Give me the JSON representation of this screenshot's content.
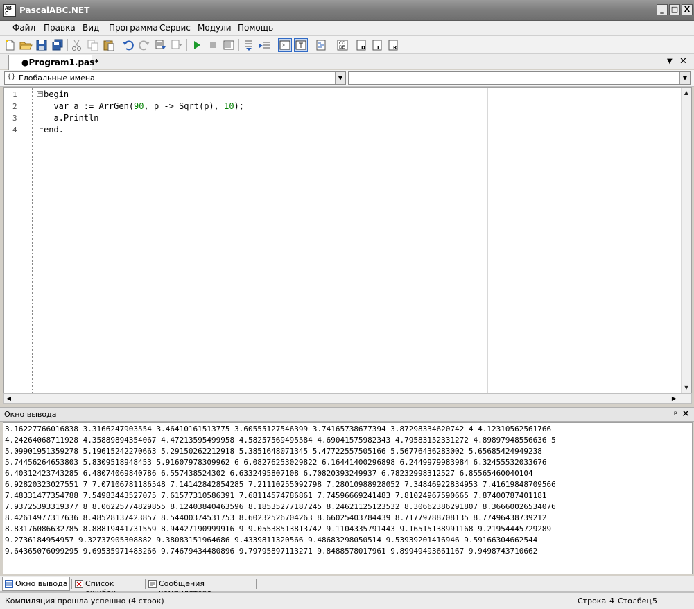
{
  "window": {
    "title": "PascalABC.NET",
    "icon_text": "AB C",
    "minimize": "_",
    "maximize": "□",
    "close": "X"
  },
  "menu": [
    "Файл",
    "Правка",
    "Вид",
    "Программа",
    "Сервис",
    "Модули",
    "Помощь"
  ],
  "toolbar": {
    "icons": [
      "new-file-icon",
      "open-icon",
      "save-icon",
      "save-all-icon",
      "cut-icon",
      "copy-icon",
      "paste-icon",
      "undo-icon",
      "redo-icon",
      "compile-icon",
      "build-icon",
      "run-icon",
      "stop-icon",
      "debug-icon",
      "step-into-icon",
      "step-over-icon",
      "output-toggle-icon",
      "text-mode-icon",
      "format-icon",
      "code-template-icon",
      "doc-icon",
      "lib-icon",
      "ref-icon"
    ]
  },
  "tabs": {
    "active": "●Program1.pas*",
    "dropdown": "▼",
    "close": "✕"
  },
  "nav": {
    "left_combo": "Глобальные имена",
    "left_icon": "{}",
    "right_combo": "",
    "arrow": "▼"
  },
  "editor": {
    "line_numbers": [
      "1",
      "2",
      "3",
      "4"
    ],
    "lines": [
      {
        "text": "begin",
        "indent": 0
      },
      {
        "text": "  var a := ArrGen(90, p -> Sqrt(p), 10);",
        "indent": 0
      },
      {
        "text": "  a.Println",
        "indent": 0
      },
      {
        "text": "end.",
        "indent": 0
      }
    ],
    "line2_parts": {
      "pre": "  var a := ArrGen(",
      "n1": "90",
      "mid": ", p -> Sqrt(p), ",
      "n2": "10",
      "post": ");"
    }
  },
  "output": {
    "title": "Окно вывода",
    "pin": "ᵖ",
    "close": "✕",
    "lines": [
      "3.16227766016838 3.3166247903554 3.46410161513775 3.60555127546399 3.74165738677394 3.87298334620742 4 4.12310562561766",
      "4.24264068711928 4.35889894354067 4.47213595499958 4.58257569495584 4.69041575982343 4.79583152331272 4.89897948556636 5",
      "5.09901951359278 5.19615242270663 5.29150262212918 5.3851648071345 5.47722557505166 5.56776436283002 5.65685424949238",
      "5.74456264653803 5.8309518948453 5.91607978309962 6 6.08276253029822 6.16441400296898 6.2449979983984 6.32455532033676",
      "6.40312423743285 6.48074069840786 6.557438524302 6.6332495807108 6.70820393249937 6.78232998312527 6.85565460040104",
      "6.92820323027551 7 7.07106781186548 7.14142842854285 7.21110255092798 7.28010988928052 7.34846922834953 7.41619848709566",
      "7.48331477354788 7.54983443527075 7.61577310586391 7.68114574786861 7.74596669241483 7.81024967590665 7.87400787401181",
      "7.93725393319377 8 8.06225774829855 8.12403840463596 8.18535277187245 8.24621125123532 8.30662386291807 8.36660026534076",
      "8.42614977317636 8.48528137423857 8.54400374531753 8.60232526704263 8.66025403784439 8.71779788708135 8.77496438739212",
      "8.83176086632785 8.88819441731559 8.94427190999916 9 9.05538513813742 9.1104335791443 9.16515138991168 9.21954445729289",
      "9.2736184954957 9.32737905308882 9.38083151964686 9.4339811320566 9.48683298050514 9.53939201416946 9.59166304662544",
      "9.64365076099295 9.69535971483266 9.74679434480896 9.79795897113271 9.8488578017961 9.89949493661167 9.9498743710662"
    ]
  },
  "bottom_tabs": [
    "Окно вывода",
    "Список ошибок",
    "Сообщения компилятора"
  ],
  "status": {
    "message": "Компиляция прошла успешно (4 строк)",
    "row_label": "Строка",
    "row": "4",
    "col_label": "Столбец",
    "col": "5"
  }
}
